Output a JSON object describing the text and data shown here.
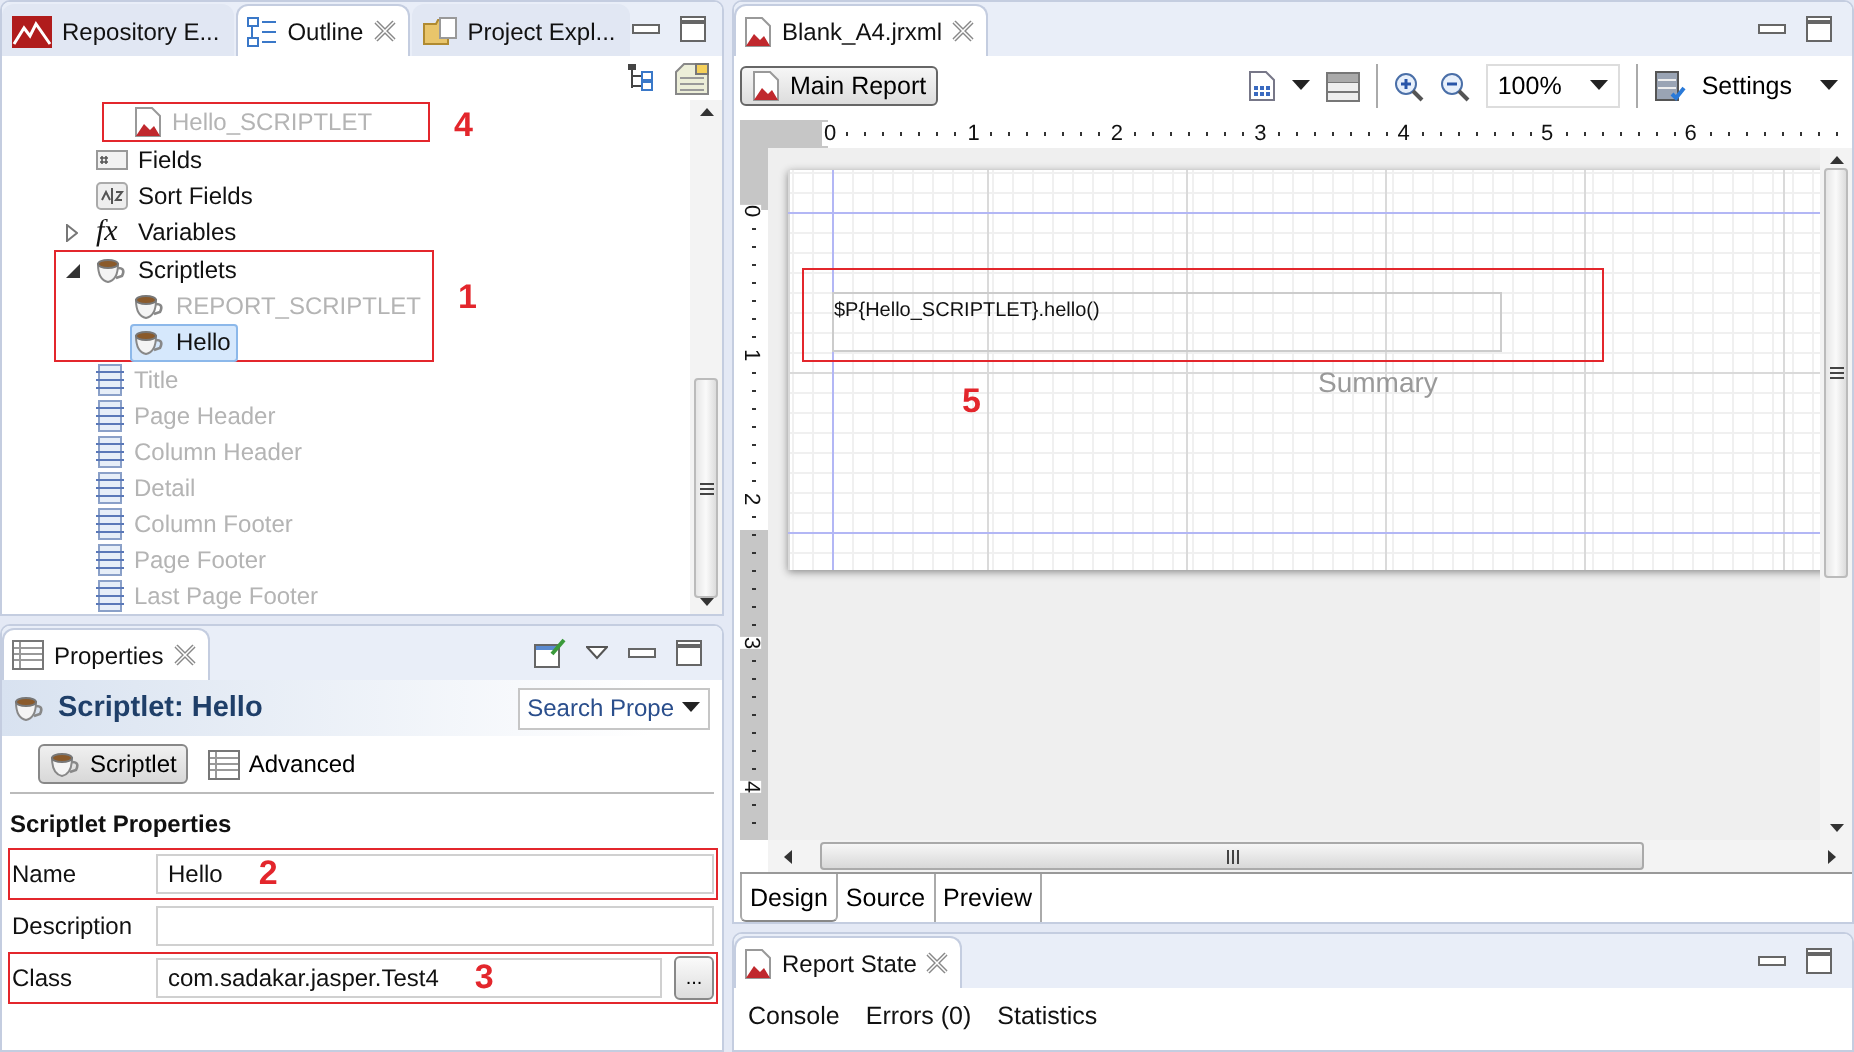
{
  "outline_panel": {
    "tabs": [
      {
        "label": "Repository E...",
        "kind": "repository",
        "selected": false,
        "closable": false
      },
      {
        "label": "Outline",
        "kind": "outline",
        "selected": true,
        "closable": true
      },
      {
        "label": "Project Expl...",
        "kind": "project",
        "selected": false,
        "closable": false
      }
    ],
    "tree": {
      "continued_children": [
        {
          "label": "Hello_SCRIPTLET",
          "kind": "parameter",
          "disabled": true,
          "selected": false,
          "annotation": "4"
        }
      ],
      "items": [
        {
          "label": "Fields",
          "kind": "fields",
          "disabled": false,
          "selected": false
        },
        {
          "label": "Sort Fields",
          "kind": "sort",
          "disabled": false,
          "selected": false
        },
        {
          "label": "Variables",
          "kind": "variables",
          "glyph": "fx",
          "disabled": false,
          "selected": false,
          "expanded": false
        },
        {
          "label": "Scriptlets",
          "kind": "scriptlet",
          "disabled": false,
          "selected": false,
          "expanded": true,
          "annotation": "1",
          "children": [
            {
              "label": "REPORT_SCRIPTLET",
              "kind": "scriptlet",
              "disabled": true,
              "selected": false
            },
            {
              "label": "Hello",
              "kind": "scriptlet",
              "disabled": false,
              "selected": true
            }
          ]
        },
        {
          "label": "Title",
          "kind": "band",
          "disabled": true,
          "selected": false
        },
        {
          "label": "Page Header",
          "kind": "band",
          "disabled": true,
          "selected": false
        },
        {
          "label": "Column Header",
          "kind": "band",
          "disabled": true,
          "selected": false
        },
        {
          "label": "Detail",
          "kind": "band",
          "disabled": true,
          "selected": false
        },
        {
          "label": "Column Footer",
          "kind": "band",
          "disabled": true,
          "selected": false
        },
        {
          "label": "Page Footer",
          "kind": "band",
          "disabled": true,
          "selected": false
        },
        {
          "label": "Last Page Footer",
          "kind": "band",
          "disabled": true,
          "selected": false
        }
      ]
    }
  },
  "properties_panel": {
    "tab": "Properties",
    "title": "Scriptlet: Hello",
    "search": "Search Prope",
    "section_tabs": [
      {
        "label": "Scriptlet",
        "kind": "scriptlet",
        "selected": true
      },
      {
        "label": "Advanced",
        "kind": "table",
        "selected": false
      }
    ],
    "section_title": "Scriptlet Properties",
    "fields": [
      {
        "label": "Name",
        "value": "Hello",
        "annotation": "2"
      },
      {
        "label": "Description"
      },
      {
        "label": "Class",
        "value": "com.sadakar.jasper.Test4",
        "annotation": "3",
        "button": "..."
      }
    ]
  },
  "editor": {
    "tab": "Blank_A4.jrxml",
    "main_report_button": "Main Report",
    "zoom": "100%",
    "settings": "Settings",
    "rulers": {
      "horizontal": [
        "0",
        "1",
        "2",
        "3",
        "4",
        "5",
        "6"
      ],
      "vertical": [
        "0",
        "1",
        "2",
        "3",
        "4"
      ]
    },
    "canvas": {
      "elements": [
        {
          "kind": "text_field",
          "expression": "$P{Hello_SCRIPTLET}.hello()",
          "annotation": "5"
        }
      ],
      "band_label": "Summary"
    },
    "bottom_tabs": [
      {
        "label": "Design",
        "selected": true
      },
      {
        "label": "Source",
        "selected": false
      },
      {
        "label": "Preview",
        "selected": false
      }
    ]
  },
  "report_state_panel": {
    "tab": "Report State",
    "tabs": [
      "Console",
      "Errors (0)",
      "Statistics"
    ]
  }
}
